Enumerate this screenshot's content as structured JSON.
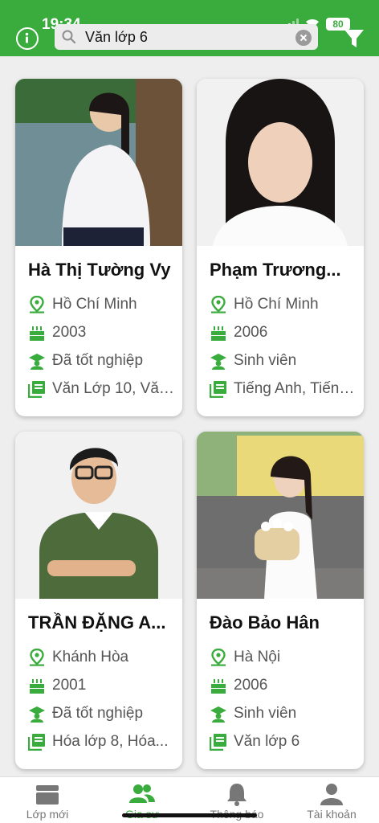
{
  "status_bar": {
    "time": "19:34",
    "battery": "80"
  },
  "search": {
    "value": "Văn lớp 6",
    "placeholder": ""
  },
  "colors": {
    "brand": "#3aab3d",
    "icon_gray": "#777777"
  },
  "tutors": [
    {
      "name": "Hà Thị Tường Vy",
      "location": "Hồ Chí Minh",
      "birth_year": "2003",
      "status": "Đã tốt nghiệp",
      "subjects": "Văn Lớp 10, Văn..."
    },
    {
      "name": "Phạm Trương...",
      "location": "Hồ Chí Minh",
      "birth_year": "2006",
      "status": "Sinh viên",
      "subjects": "Tiếng Anh, Tiếng..."
    },
    {
      "name": "TRẦN ĐẶNG A...",
      "location": "Khánh Hòa",
      "birth_year": "2001",
      "status": "Đã tốt nghiệp",
      "subjects": "Hóa lớp 8, Hóa..."
    },
    {
      "name": "Đào Bảo Hân",
      "location": "Hà Nội",
      "birth_year": "2006",
      "status": "Sinh viên",
      "subjects": "Văn lớp 6"
    }
  ],
  "icons": {
    "location": "map-pin-icon",
    "birth_year": "birthday-cake-icon",
    "status": "graduation-cap-icon",
    "subjects": "book-icon"
  },
  "tabs": [
    {
      "label": "Lớp mới",
      "icon": "inbox-icon"
    },
    {
      "label": "Gia sư",
      "icon": "users-icon"
    },
    {
      "label": "Thông báo",
      "icon": "bell-icon"
    },
    {
      "label": "Tài khoản",
      "icon": "user-icon"
    }
  ]
}
